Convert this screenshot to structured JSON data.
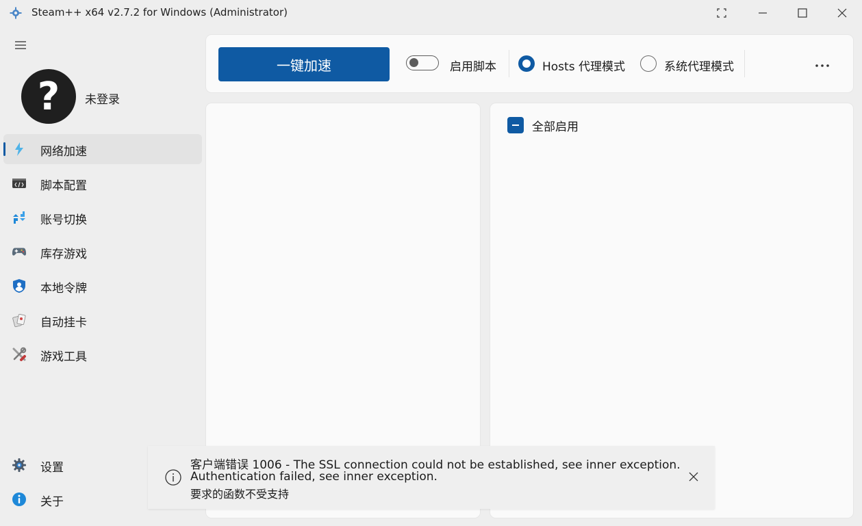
{
  "window": {
    "title": "Steam++ x64 v2.7.2 for Windows (Administrator)",
    "icon": "steam-plus-plus-logo"
  },
  "window_controls": [
    {
      "name": "fullscreen",
      "icon": "fullscreen-icon"
    },
    {
      "name": "minimize",
      "icon": "minimize-icon"
    },
    {
      "name": "maximize",
      "icon": "maximize-icon"
    },
    {
      "name": "close",
      "icon": "close-icon"
    }
  ],
  "sidebar": {
    "menu_icon": "hamburger-menu-icon",
    "user": {
      "avatar_glyph": "?",
      "status_label": "未登录"
    },
    "items": [
      {
        "label": "网络加速",
        "icon": "lightning-icon",
        "active": true
      },
      {
        "label": "脚本配置",
        "icon": "code-window-icon",
        "active": false
      },
      {
        "label": "账号切换",
        "icon": "switch-arrows-icon",
        "active": false
      },
      {
        "label": "库存游戏",
        "icon": "gamepad-icon",
        "active": false
      },
      {
        "label": "本地令牌",
        "icon": "shield-user-icon",
        "active": false
      },
      {
        "label": "自动挂卡",
        "icon": "cards-icon",
        "active": false
      },
      {
        "label": "游戏工具",
        "icon": "tools-icon",
        "active": false
      }
    ],
    "bottom_items": [
      {
        "label": "设置",
        "icon": "gear-icon"
      },
      {
        "label": "关于",
        "icon": "info-icon"
      }
    ]
  },
  "toolbar": {
    "accelerate_label": "一键加速",
    "script_toggle_label": "启用脚本",
    "script_toggle_on": false,
    "proxy_modes": [
      {
        "label": "Hosts 代理模式",
        "selected": true
      },
      {
        "label": "系统代理模式",
        "selected": false
      }
    ],
    "more_icon": "more-horizontal-icon"
  },
  "right_panel": {
    "enable_all_label": "全部启用",
    "enable_all_state": "indeterminate"
  },
  "toast": {
    "icon": "info-circle-icon",
    "line1": "客户端错误 1006 - The SSL connection could not be established, see inner exception.",
    "line2": "Authentication failed, see inner exception.",
    "line3": "要求的函数不受支持",
    "close_icon": "close-icon"
  },
  "colors": {
    "accent": "#0f5aa3",
    "background": "#eeeeee",
    "card": "#fafafa"
  }
}
